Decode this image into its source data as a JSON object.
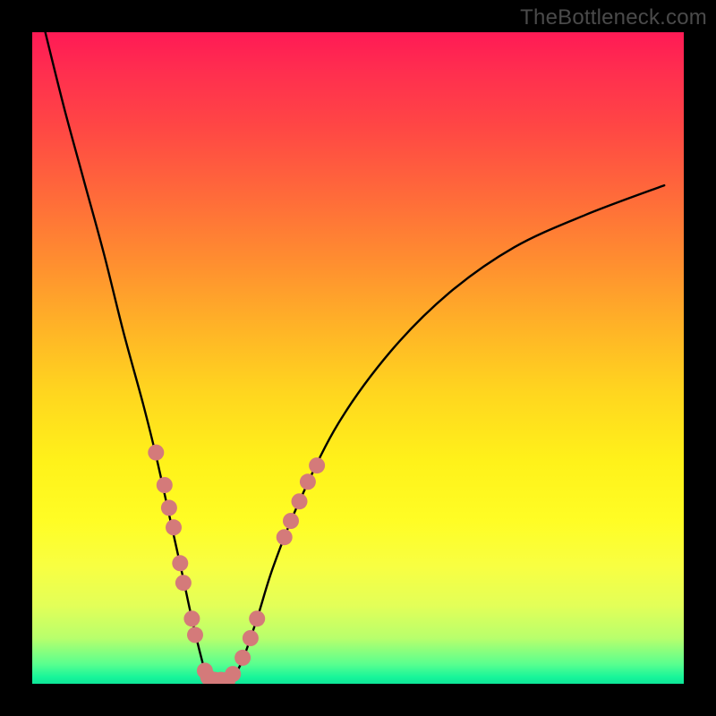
{
  "watermark": {
    "text": "TheBottleneck.com"
  },
  "chart_data": {
    "type": "line",
    "title": "",
    "xlabel": "",
    "ylabel": "",
    "xlim": [
      0,
      100
    ],
    "ylim": [
      0,
      100
    ],
    "gradient_stops": [
      {
        "pos": 0,
        "color": "#ff1a55"
      },
      {
        "pos": 25,
        "color": "#ff6a3a"
      },
      {
        "pos": 55,
        "color": "#ffd51f"
      },
      {
        "pos": 82,
        "color": "#f8ff42"
      },
      {
        "pos": 97,
        "color": "#59ff8f"
      },
      {
        "pos": 100,
        "color": "#0ee497"
      }
    ],
    "series": [
      {
        "name": "bottleneck-curve",
        "color": "#000000",
        "x": [
          2.0,
          5.0,
          8.0,
          11.0,
          14.0,
          17.0,
          19.0,
          21.0,
          23.0,
          24.5,
          26.0,
          26.7,
          27.5,
          30.0,
          32.0,
          34.5,
          37.0,
          41.0,
          47.0,
          55.0,
          64.0,
          74.0,
          85.0,
          97.0
        ],
        "y": [
          100.0,
          88.0,
          77.0,
          66.0,
          54.0,
          43.0,
          35.0,
          26.0,
          17.0,
          10.0,
          3.8,
          1.5,
          0.6,
          0.6,
          3.0,
          10.0,
          18.0,
          28.0,
          40.0,
          51.0,
          60.0,
          67.0,
          72.0,
          76.5
        ]
      }
    ],
    "markers": {
      "name": "highlight-points",
      "color": "#d47a7a",
      "radius_px": 9,
      "points": [
        {
          "x": 19.0,
          "y": 35.5
        },
        {
          "x": 20.3,
          "y": 30.5
        },
        {
          "x": 21.0,
          "y": 27.0
        },
        {
          "x": 21.7,
          "y": 24.0
        },
        {
          "x": 22.7,
          "y": 18.5
        },
        {
          "x": 23.2,
          "y": 15.5
        },
        {
          "x": 24.5,
          "y": 10.0
        },
        {
          "x": 25.0,
          "y": 7.5
        },
        {
          "x": 26.5,
          "y": 2.0
        },
        {
          "x": 27.0,
          "y": 1.0
        },
        {
          "x": 28.0,
          "y": 0.6
        },
        {
          "x": 29.0,
          "y": 0.6
        },
        {
          "x": 30.0,
          "y": 0.6
        },
        {
          "x": 30.8,
          "y": 1.5
        },
        {
          "x": 32.3,
          "y": 4.0
        },
        {
          "x": 33.5,
          "y": 7.0
        },
        {
          "x": 34.5,
          "y": 10.0
        },
        {
          "x": 38.7,
          "y": 22.5
        },
        {
          "x": 39.7,
          "y": 25.0
        },
        {
          "x": 41.0,
          "y": 28.0
        },
        {
          "x": 42.3,
          "y": 31.0
        },
        {
          "x": 43.7,
          "y": 33.5
        }
      ]
    }
  }
}
